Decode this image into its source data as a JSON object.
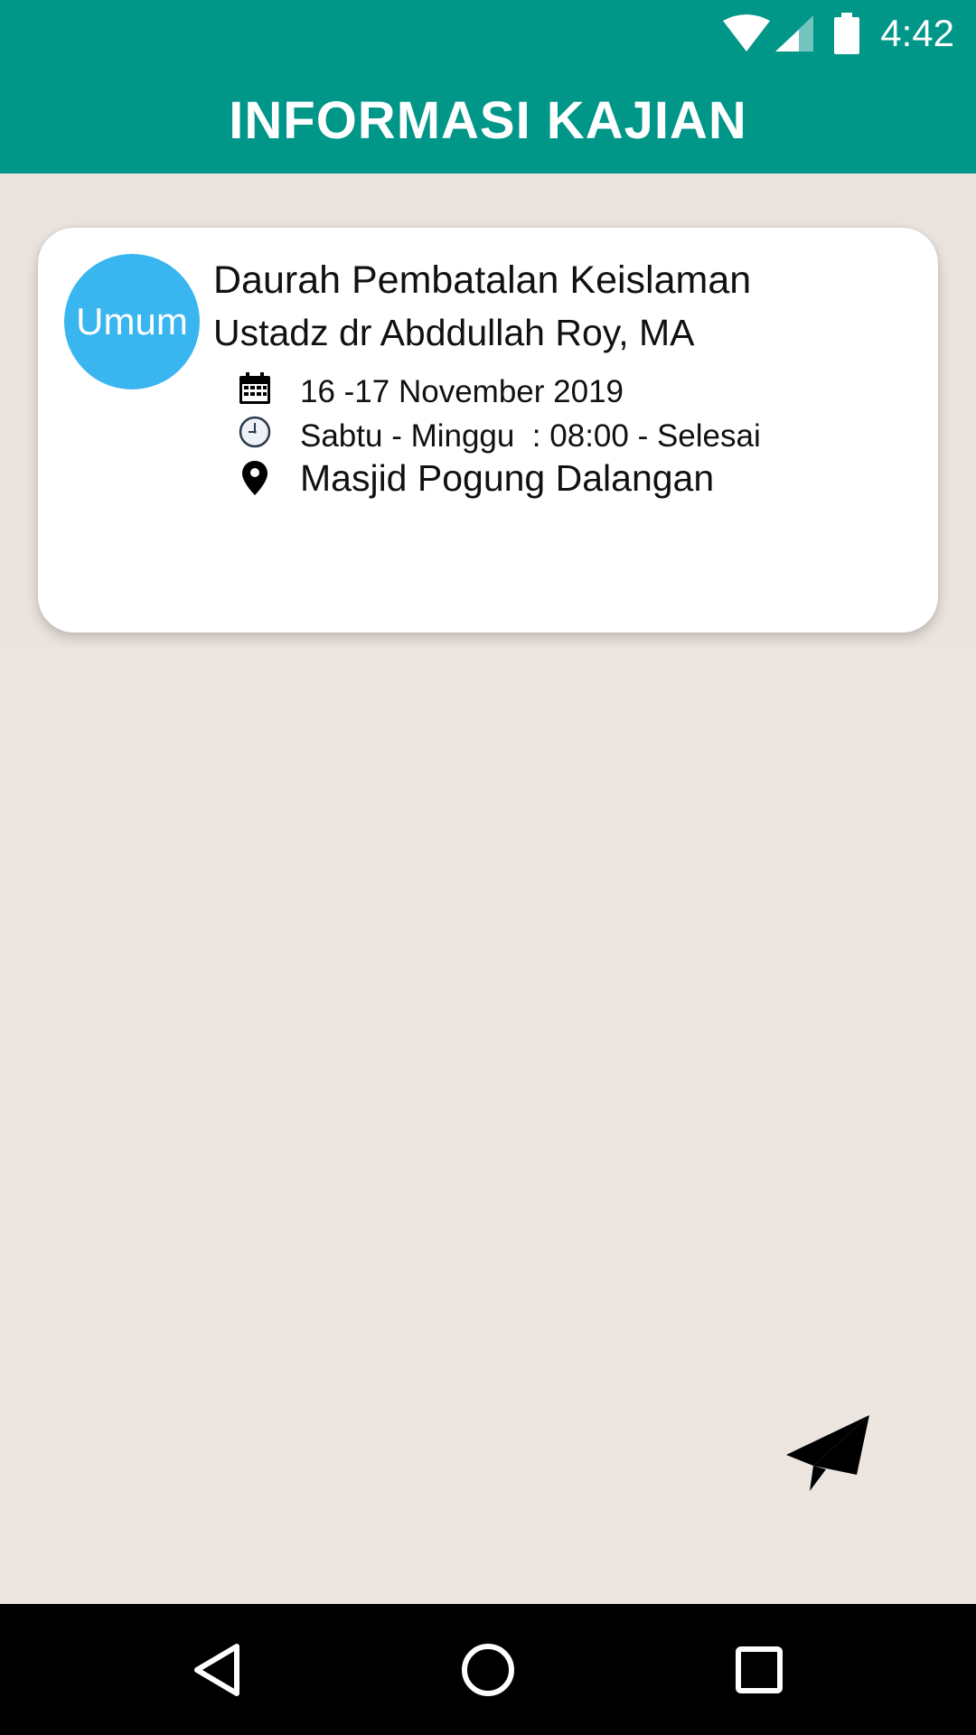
{
  "status_bar": {
    "time": "4:42",
    "icons": [
      "wifi-icon",
      "signal-icon",
      "battery-icon"
    ]
  },
  "app_bar": {
    "title": "INFORMASI KAJIAN"
  },
  "events": [
    {
      "category": "Umum",
      "title": "Daurah Pembatalan Keislaman",
      "speaker": "Ustadz dr Abddullah Roy, MA",
      "date": "16 -17 November 2019",
      "time": "Sabtu - Minggu  : 08:00 - Selesai",
      "location": "Masjid Pogung Dalangan",
      "icons": [
        "calendar-icon",
        "clock-icon",
        "location-pin-icon"
      ]
    }
  ],
  "fab": {
    "icon": "send-icon"
  },
  "nav_bar": {
    "icons": [
      "back-icon",
      "home-icon",
      "recents-icon"
    ]
  },
  "colors": {
    "primary": "#009688",
    "badge": "#39B5EF",
    "background": "#ECE5E0",
    "card": "#FFFFFF"
  }
}
